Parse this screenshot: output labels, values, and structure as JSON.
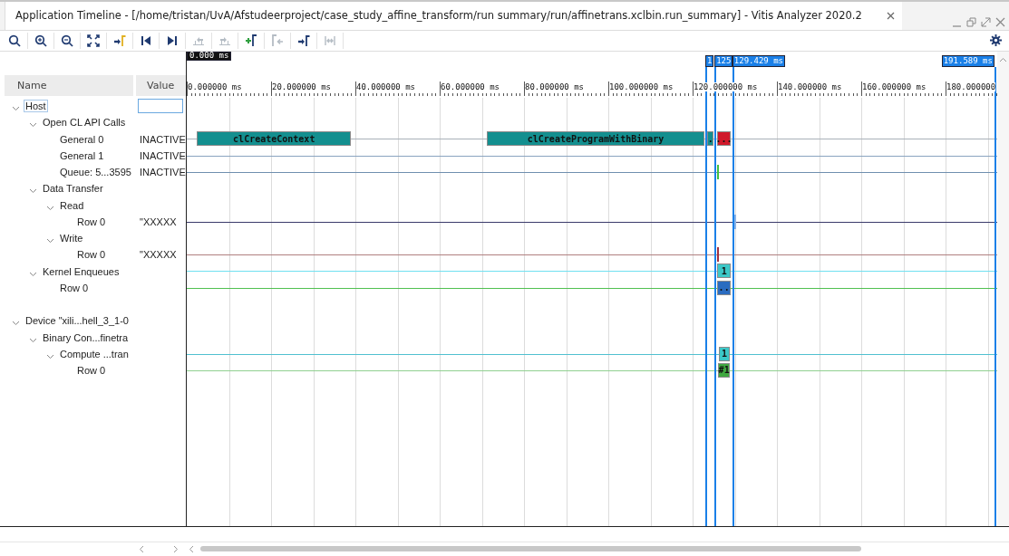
{
  "window": {
    "title": "Application Timeline - [/home/tristan/UvA/Afstudeerproject/case_study_affine_transform/run summary/run/affinetrans.xclbin.run_summary] - Vitis Analyzer 2020.2"
  },
  "toolbar": [
    {
      "kind": "search",
      "disabled": false
    },
    {
      "kind": "zoom-in",
      "disabled": false
    },
    {
      "kind": "zoom-out",
      "disabled": false
    },
    {
      "kind": "fit",
      "disabled": false
    },
    {
      "kind": "goto-marker",
      "disabled": false
    },
    {
      "kind": "go-start",
      "disabled": false
    },
    {
      "kind": "go-end",
      "disabled": false
    },
    {
      "kind": "prev-event",
      "disabled": true
    },
    {
      "kind": "next-event",
      "disabled": true
    },
    {
      "kind": "add-marker",
      "disabled": false
    },
    {
      "kind": "prev-marker",
      "disabled": true
    },
    {
      "kind": "next-marker",
      "disabled": false
    },
    {
      "kind": "span",
      "disabled": true
    }
  ],
  "tree_header": {
    "name_column": "Name",
    "value_column": "Value"
  },
  "tree": [
    {
      "name": "Host",
      "selected": true,
      "expanded": true,
      "children": [
        {
          "name": "Open CL API Calls",
          "selected": false,
          "expanded": true,
          "children": [
            {
              "name": "General 0",
              "selected": false,
              "value": "INACTIVE",
              "color": "#a8b0b8",
              "events": [
                {
                  "label": "clCreateContext",
                  "color": "#138f8f"
                },
                {
                  "label": "clCreateProgramWithBinary",
                  "color": "#138f8f"
                },
                {
                  "label": ".",
                  "color": "#138f8f"
                },
                {
                  "label": "...",
                  "color": "#d0182a"
                }
              ]
            },
            {
              "name": "General 1",
              "selected": false,
              "value": "INACTIVE",
              "color": "#8aa4c0"
            },
            {
              "name": "Queue: 5...3595",
              "selected": false,
              "value": "INACTIVE",
              "color": "#6f8faf",
              "events": [
                {
                  "color": "#40c040"
                }
              ]
            }
          ]
        },
        {
          "name": "Data Transfer",
          "selected": false,
          "expanded": true,
          "children": [
            {
              "name": "Read",
              "selected": false,
              "expanded": true,
              "children": [
                {
                  "name": "Row 0",
                  "selected": false,
                  "value": "\"XXXXX",
                  "color": "#3a3a6a",
                  "events": [
                    {
                      "color": "#8ab4e8"
                    }
                  ]
                }
              ]
            },
            {
              "name": "Write",
              "selected": false,
              "expanded": true,
              "children": [
                {
                  "name": "Row 0",
                  "selected": false,
                  "value": "\"XXXXX",
                  "color": "#b08080",
                  "events": [
                    {
                      "color": "#a03040"
                    }
                  ]
                }
              ]
            }
          ]
        },
        {
          "name": "Kernel Enqueues",
          "selected": false,
          "expanded": true,
          "color": "#70e0f0",
          "events": [
            {
              "label": "1",
              "color": "#3cc8c8"
            }
          ],
          "children": [
            {
              "name": "Row 0",
              "selected": false,
              "color": "#50c050",
              "events": [
                {
                  "label": "..",
                  "color": "#2a6cc0"
                }
              ]
            }
          ]
        }
      ]
    },
    {
      "name": "Device \"xili...hell_3_1-0",
      "selected": false,
      "expanded": true,
      "children": [
        {
          "name": "Binary Con...finetra",
          "selected": false,
          "expanded": true,
          "children": [
            {
              "name": "Compute ...tran",
              "selected": false,
              "expanded": true,
              "color": "#50c0d0",
              "events": [
                {
                  "label": "1",
                  "color": "#3cc8c8"
                }
              ],
              "children": [
                {
                  "name": "Row 0",
                  "selected": false,
                  "color": "#90d090",
                  "events": [
                    {
                      "label": "#1",
                      "color": "#40a840"
                    }
                  ]
                }
              ]
            }
          ]
        }
      ]
    }
  ],
  "timeline": {
    "axis_labels": [
      "0.000000 ms",
      "20.000000 ms",
      "40.000000 ms",
      "60.000000 ms",
      "80.000000 ms",
      "100.000000 ms",
      "120.000000 ms",
      "140.000000 ms",
      "160.000000 ms",
      "180.000000"
    ],
    "markers": [
      {
        "label": "0.000 ms",
        "color": "#111111"
      },
      {
        "label": "1",
        "color": "#1a80e8"
      },
      {
        "label": "125",
        "color": "#1a80e8"
      },
      {
        "label": "129.429 ms",
        "color": "#1a80e8"
      },
      {
        "label": "191.589 ms",
        "color": "#1a80e8"
      }
    ]
  }
}
